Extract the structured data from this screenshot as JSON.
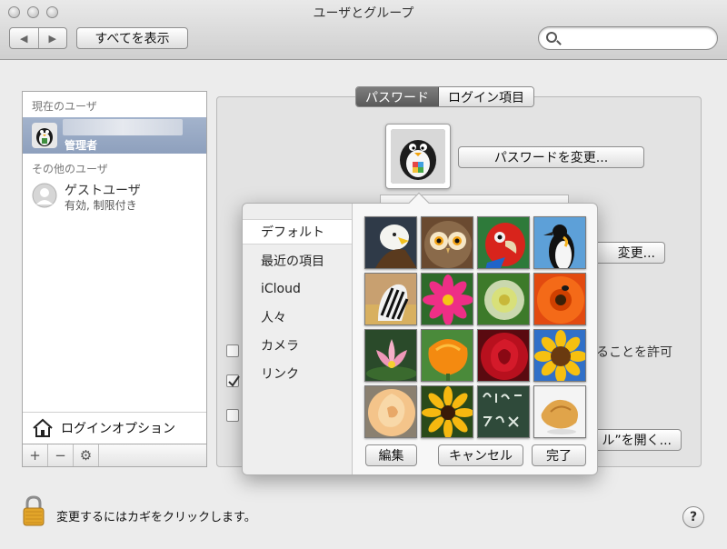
{
  "window": {
    "title": "ユーザとグループ"
  },
  "toolbar": {
    "back": "◀",
    "forward": "▶",
    "show_all": "すべてを表示",
    "search_placeholder": ""
  },
  "sidebar": {
    "current_users_heading": "現在のユーザ",
    "current_user": {
      "role": "管理者"
    },
    "other_users_heading": "その他のユーザ",
    "guest": {
      "name": "ゲストユーザ",
      "status": "有効, 制限付き"
    },
    "login_options": "ログインオプション",
    "add": "+",
    "remove": "−",
    "action": "⚙"
  },
  "tabs": {
    "password": "パスワード",
    "login_items": "ログイン項目"
  },
  "main": {
    "change_password": "パスワードを変更...",
    "change_partial": "変更...",
    "allow_partial": "ることを許可",
    "open_partial": "ル”を開く..."
  },
  "picker": {
    "categories": [
      "デフォルト",
      "最近の項目",
      "iCloud",
      "人々",
      "カメラ",
      "リンク"
    ],
    "selected_index": 0,
    "thumbnails": [
      "eagle",
      "owl",
      "parrot",
      "penguin",
      "zebra",
      "pink-dahlia",
      "dandelion",
      "orange-gerbera",
      "lotus",
      "orange-poppy",
      "red-rose",
      "sunflower",
      "yellow-rose",
      "black-eyed-susan",
      "chalkboard",
      "fortune-cookie"
    ],
    "edit": "編集",
    "cancel": "キャンセル",
    "done": "完了"
  },
  "footer": {
    "lock_text": "変更するにはカギをクリックします。",
    "help": "?"
  }
}
